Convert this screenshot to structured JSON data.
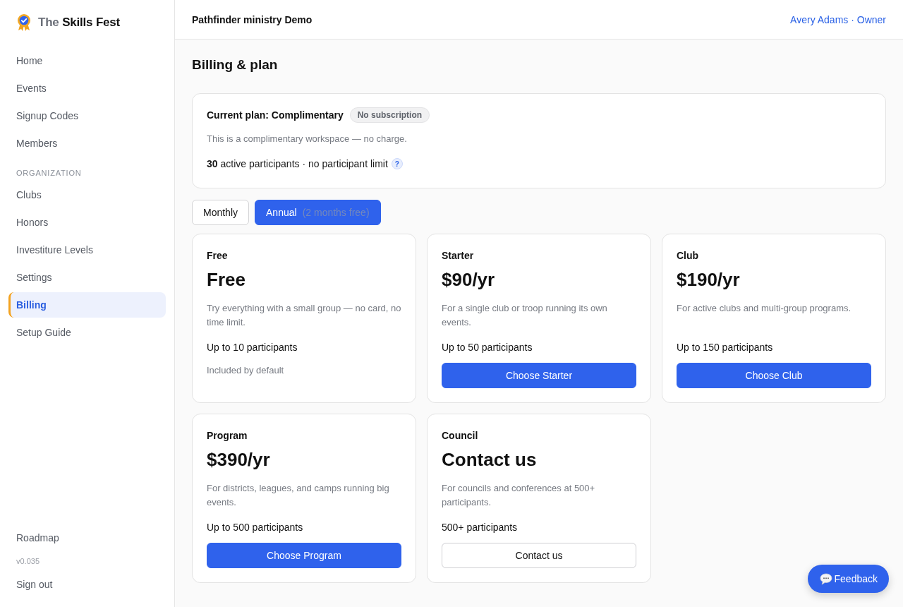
{
  "sidebar": {
    "brand": "The **Skills Fest**",
    "groups": [
      {
        "items": [
          {
            "label": "Home",
            "selected": false
          },
          {
            "label": "Events",
            "selected": false
          },
          {
            "label": "Signup Codes",
            "selected": false
          },
          {
            "label": "Members",
            "selected": false
          }
        ]
      },
      {
        "heading": "ORGANIZATION",
        "items": [
          {
            "label": "Clubs",
            "selected": false
          },
          {
            "label": "Honors",
            "selected": false
          },
          {
            "label": "Investiture Levels",
            "selected": false
          },
          {
            "label": "Settings",
            "selected": false
          },
          {
            "label": "Billing",
            "selected": true
          },
          {
            "label": "Setup Guide",
            "selected": false
          }
        ]
      }
    ],
    "roadmap": "Roadmap",
    "version": "v0.035",
    "sign_out": "Sign out"
  },
  "header": {
    "workspace": "Pathfinder ministry Demo",
    "user": "Avery Adams · Owner"
  },
  "page_title": "Billing & plan",
  "current_plan": {
    "title": "Current plan: Complimentary",
    "badge": "No subscription",
    "description": "This is a complimentary workspace — no charge.",
    "usage": "**30** active participants · no participant limit",
    "help": "?"
  },
  "billing_toggle": [
    {
      "label": "Monthly",
      "selected": false
    },
    {
      "label": "Annual",
      "note": "(2 months free)",
      "selected": true
    }
  ],
  "plans": [
    {
      "name": "Free",
      "price": "Free",
      "description": "Try everything with a small group — no card, no time limit.",
      "limit": "Up to 10 participants",
      "action": {
        "kind": "note",
        "label": "Included by default"
      }
    },
    {
      "name": "Starter",
      "price": "$90/yr",
      "description": "For a single club or troop running its own events.",
      "limit": "Up to 50 participants",
      "action": {
        "kind": "primary",
        "label": "Choose Starter"
      }
    },
    {
      "name": "Club",
      "price": "$190/yr",
      "description": "For active clubs and multi-group programs.",
      "limit": "Up to 150 participants",
      "action": {
        "kind": "primary",
        "label": "Choose Club"
      }
    },
    {
      "name": "Program",
      "price": "$390/yr",
      "description": "For districts, leagues, and camps running big events.",
      "limit": "Up to 500 participants",
      "action": {
        "kind": "primary",
        "label": "Choose Program"
      }
    },
    {
      "name": "Council",
      "price": "Contact us",
      "description": "For councils and conferences at 500+ participants.",
      "limit": "500+ participants",
      "action": {
        "kind": "secondary",
        "label": "Contact us"
      }
    }
  ],
  "feedback_button": "Feedback"
}
